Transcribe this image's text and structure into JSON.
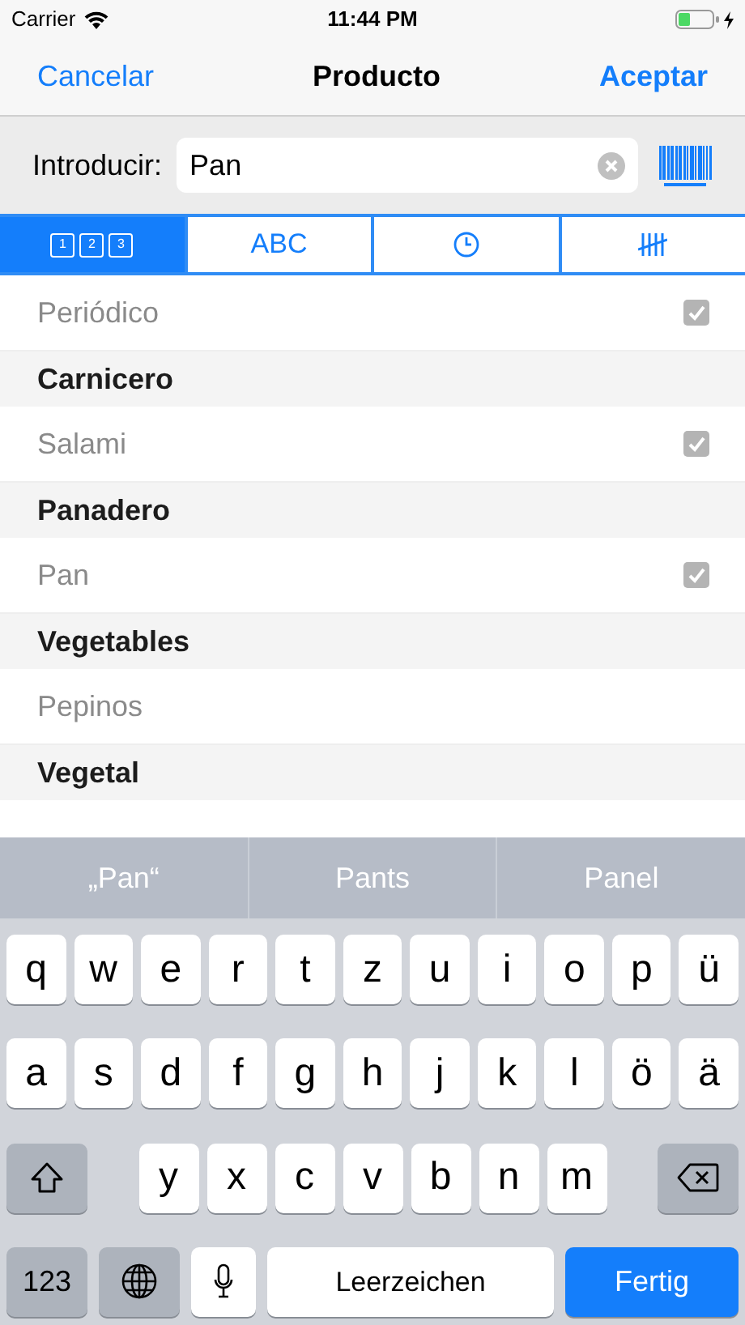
{
  "status_bar": {
    "carrier": "Carrier",
    "time": "11:44 PM",
    "charging": true
  },
  "nav": {
    "cancel": "Cancelar",
    "title": "Producto",
    "accept": "Aceptar"
  },
  "entry": {
    "label": "Introducir:",
    "value": "Pan"
  },
  "tabs": [
    {
      "kind": "digits",
      "digits": [
        "1",
        "2",
        "3"
      ],
      "selected": true
    },
    {
      "kind": "text",
      "label": "ABC",
      "selected": false
    },
    {
      "kind": "clock",
      "selected": false
    },
    {
      "kind": "tally",
      "selected": false
    }
  ],
  "rows": [
    {
      "kind": "item",
      "label": "Periódico",
      "checked": true
    },
    {
      "kind": "header",
      "label": "Carnicero"
    },
    {
      "kind": "item",
      "label": "Salami",
      "checked": true
    },
    {
      "kind": "header",
      "label": "Panadero"
    },
    {
      "kind": "item",
      "label": "Pan",
      "checked": true
    },
    {
      "kind": "header",
      "label": "Vegetables"
    },
    {
      "kind": "item",
      "label": "Pepinos",
      "checked": false
    },
    {
      "kind": "header",
      "label": "Vegetal"
    }
  ],
  "keyboard": {
    "suggestions": [
      "„Pan“",
      "Pants",
      "Panel"
    ],
    "top_row": [
      "q",
      "w",
      "e",
      "r",
      "t",
      "z",
      "u",
      "i",
      "o",
      "p",
      "ü"
    ],
    "middle_row": [
      "a",
      "s",
      "d",
      "f",
      "g",
      "h",
      "j",
      "k",
      "l",
      "ö",
      "ä"
    ],
    "bottom_row": [
      "y",
      "x",
      "c",
      "v",
      "b",
      "n",
      "m"
    ],
    "numbers_key": "123",
    "space_key": "Leerzeichen",
    "done_key": "Fertig"
  }
}
